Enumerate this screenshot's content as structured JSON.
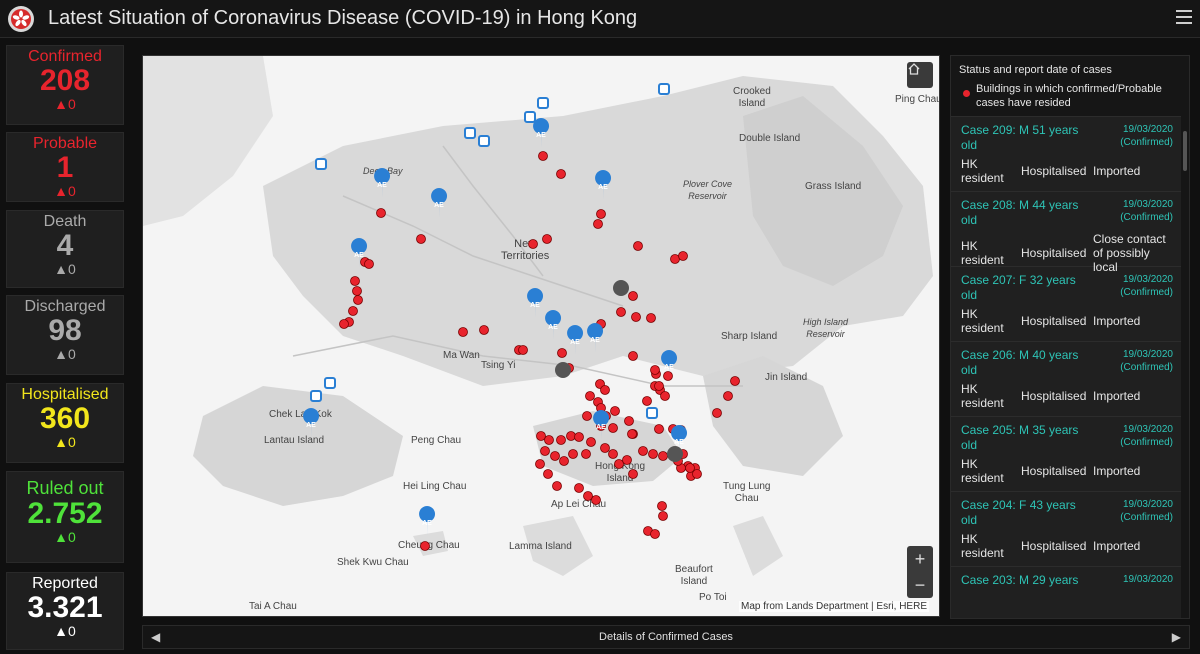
{
  "header": {
    "title": "Latest Situation of Coronavirus Disease (COVID-19) in Hong Kong"
  },
  "stats": [
    {
      "label": "Confirmed",
      "value": "208",
      "delta": "▲0",
      "color": "#e8242d"
    },
    {
      "label": "Probable",
      "value": "1",
      "delta": "▲0",
      "color": "#e8242d"
    },
    {
      "label": "Death",
      "value": "4",
      "delta": "▲0",
      "color": "#aaaaaa"
    },
    {
      "label": "Discharged",
      "value": "98",
      "delta": "▲0",
      "color": "#aaaaaa"
    },
    {
      "label": "Hospitalised",
      "value": "360",
      "delta": "▲0",
      "color": "#f2e61c"
    },
    {
      "label": "Ruled out",
      "value": "2.752",
      "delta": "▲0",
      "color": "#4fe23a"
    },
    {
      "label": "Reported",
      "value": "3.321",
      "delta": "▲0",
      "color": "#ffffff"
    }
  ],
  "map": {
    "labels": {
      "crooked": "Crooked\nIsland",
      "ping_chau": "Ping Chau",
      "double": "Double Island",
      "deep_bay": "Deep Bay",
      "plover": "Plover Cove\nReservoir",
      "grass": "Grass Island",
      "nt": "New\nTerritories",
      "sharp": "Sharp Island",
      "hi_res": "High Island\nReservoir",
      "ma_wan": "Ma Wan",
      "tsing_yi": "Tsing Yi",
      "jin": "Jin Island",
      "clk": "Chek Lap Kok",
      "peng": "Peng Chau",
      "lantau": "Lantau Island",
      "hk_island": "Hong Kong\nIsland",
      "hei_ling": "Hei Ling Chau",
      "tung_lung": "Tung Lung\nChau",
      "ap_lei": "Ap Lei Chau",
      "cheung": "Cheung Chau",
      "lamma": "Lamma Island",
      "shek_kwu": "Shek Kwu Chau",
      "beaufort": "Beaufort\nIsland",
      "po_toi": "Po Toi",
      "tai_a": "Tai A Chau"
    },
    "zoom_in": "+",
    "zoom_out": "−",
    "attribution": "Map from Lands Department | Esri, HERE"
  },
  "panel": {
    "heading": "Status and report date of  cases",
    "legend_text": "Buildings in which confirmed/Probable cases have resided",
    "cases": [
      {
        "title": "Case 209: M 51 years old",
        "date": "19/03/2020",
        "status": "(Confirmed)",
        "residency": "HK resident",
        "hospital": "Hospitalised",
        "classification": "Imported"
      },
      {
        "title": "Case 208: M 44 years old",
        "date": "19/03/2020",
        "status": "(Confirmed)",
        "residency": "HK resident",
        "hospital": "Hospitalised",
        "classification": "Close contact of possibly local"
      },
      {
        "title": "Case 207: F 32 years old",
        "date": "19/03/2020",
        "status": "(Confirmed)",
        "residency": "HK resident",
        "hospital": "Hospitalised",
        "classification": "Imported"
      },
      {
        "title": "Case 206: M 40 years old",
        "date": "19/03/2020",
        "status": "(Confirmed)",
        "residency": "HK resident",
        "hospital": "Hospitalised",
        "classification": "Imported"
      },
      {
        "title": "Case 205: M 35 years old",
        "date": "19/03/2020",
        "status": "(Confirmed)",
        "residency": "HK resident",
        "hospital": "Hospitalised",
        "classification": "Imported"
      },
      {
        "title": "Case 204: F 43 years old",
        "date": "19/03/2020",
        "status": "(Confirmed)",
        "residency": "HK resident",
        "hospital": "Hospitalised",
        "classification": "Imported"
      },
      {
        "title": "Case 203: M 29 years",
        "date": "19/03/2020",
        "status": "",
        "residency": "",
        "hospital": "",
        "classification": ""
      }
    ]
  },
  "footer": {
    "label": "Details of Confirmed Cases"
  },
  "colors": {
    "case_accent": "#2ec4b6",
    "dot": "#e8242d",
    "ae_marker": "#2a7fd4"
  }
}
